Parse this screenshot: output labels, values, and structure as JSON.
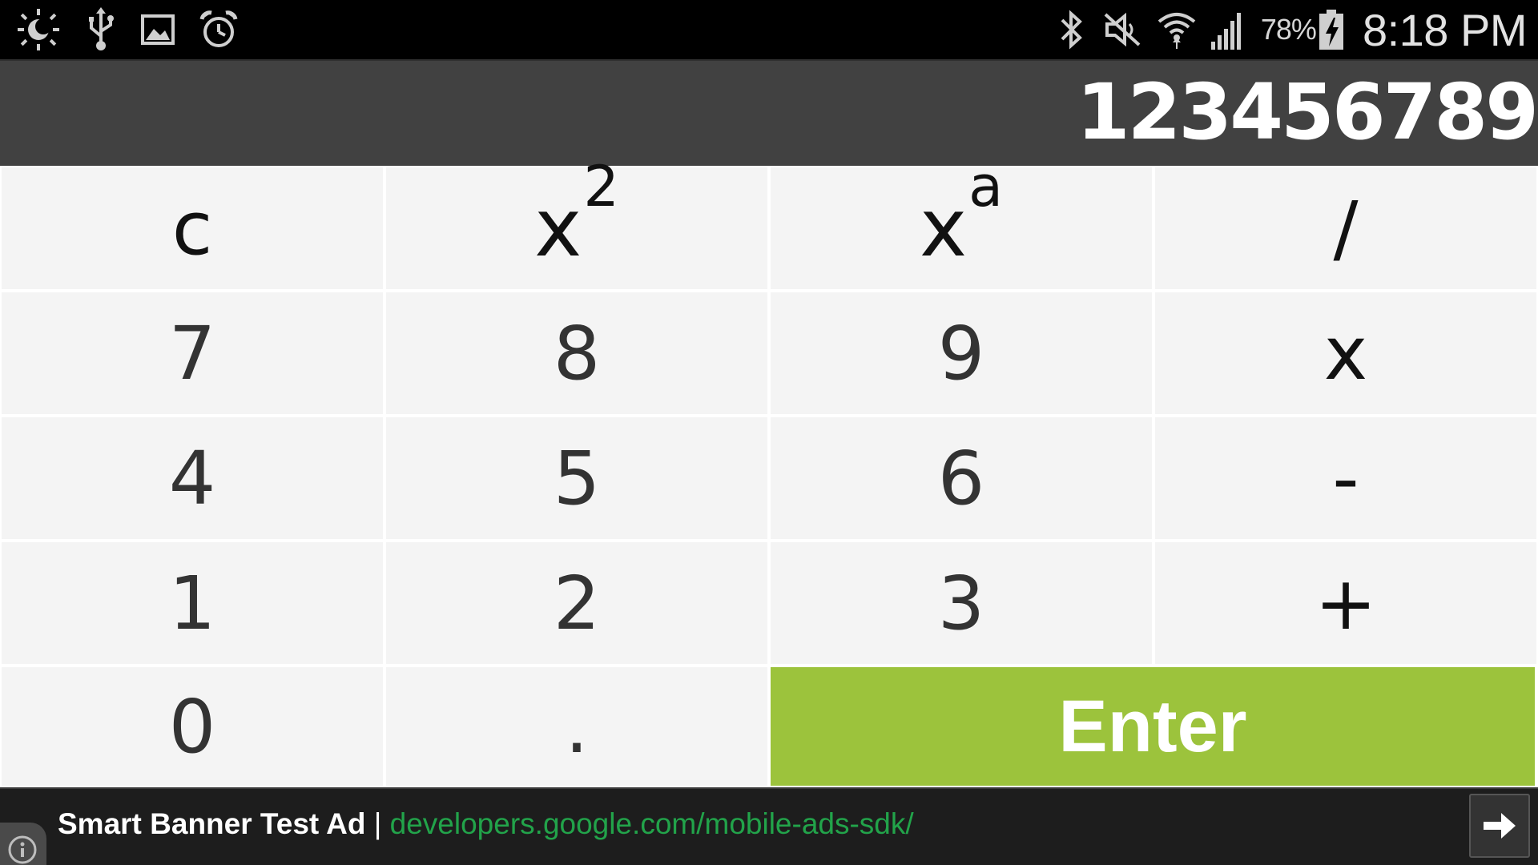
{
  "status_bar": {
    "left_icons": [
      "brightness-icon",
      "usb-icon",
      "gallery-icon",
      "alarm-icon"
    ],
    "right_icons": [
      "bluetooth-icon",
      "mute-icon",
      "wifi-icon",
      "signal-icon",
      "battery-charging-icon"
    ],
    "battery_percent": "78%",
    "time": "8:18 PM"
  },
  "display": {
    "value": "123456789"
  },
  "keypad": {
    "row1": {
      "clear": "c",
      "square_base": "x",
      "square_exp": "2",
      "power_base": "x",
      "power_exp": "a",
      "divide": "/"
    },
    "row2": {
      "seven": "7",
      "eight": "8",
      "nine": "9",
      "multiply": "x"
    },
    "row3": {
      "four": "4",
      "five": "5",
      "six": "6",
      "subtract": "-"
    },
    "row4": {
      "one": "1",
      "two": "2",
      "three": "3",
      "add": "+"
    },
    "row5": {
      "zero": "0",
      "decimal": ".",
      "enter": "Enter"
    }
  },
  "ad": {
    "title": "Smart Banner Test Ad",
    "separator": " | ",
    "url": "developers.google.com/mobile-ads-sdk/"
  },
  "colors": {
    "display_bg": "#414141",
    "key_bg": "#f4f4f4",
    "enter_bg": "#9cc33c",
    "ad_link": "#22a34a"
  }
}
